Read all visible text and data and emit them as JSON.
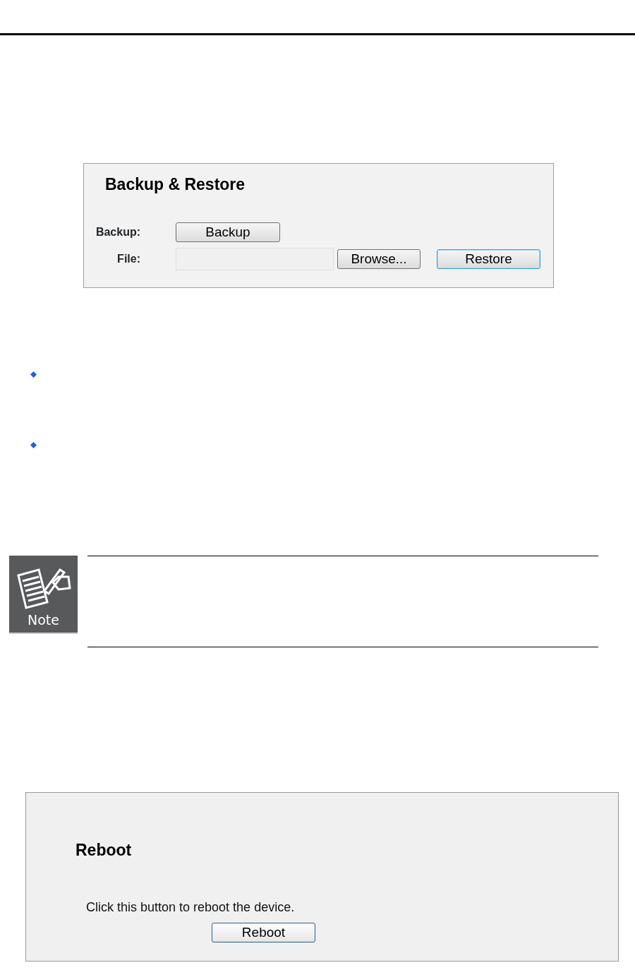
{
  "backup_panel": {
    "title": "Backup & Restore",
    "rows": [
      {
        "label": "Backup:",
        "kind": "button",
        "button": {
          "label": "Backup",
          "focused": false
        }
      },
      {
        "label": "File:",
        "kind": "file",
        "browse": {
          "label": "Browse...",
          "focused": false
        },
        "action": {
          "label": "Restore",
          "focused": true
        }
      }
    ]
  },
  "note": {
    "label": "Note"
  },
  "reboot_panel": {
    "title": "Reboot",
    "text": "Click this button to reboot the device.",
    "button": {
      "label": "Reboot",
      "focused": true
    }
  }
}
